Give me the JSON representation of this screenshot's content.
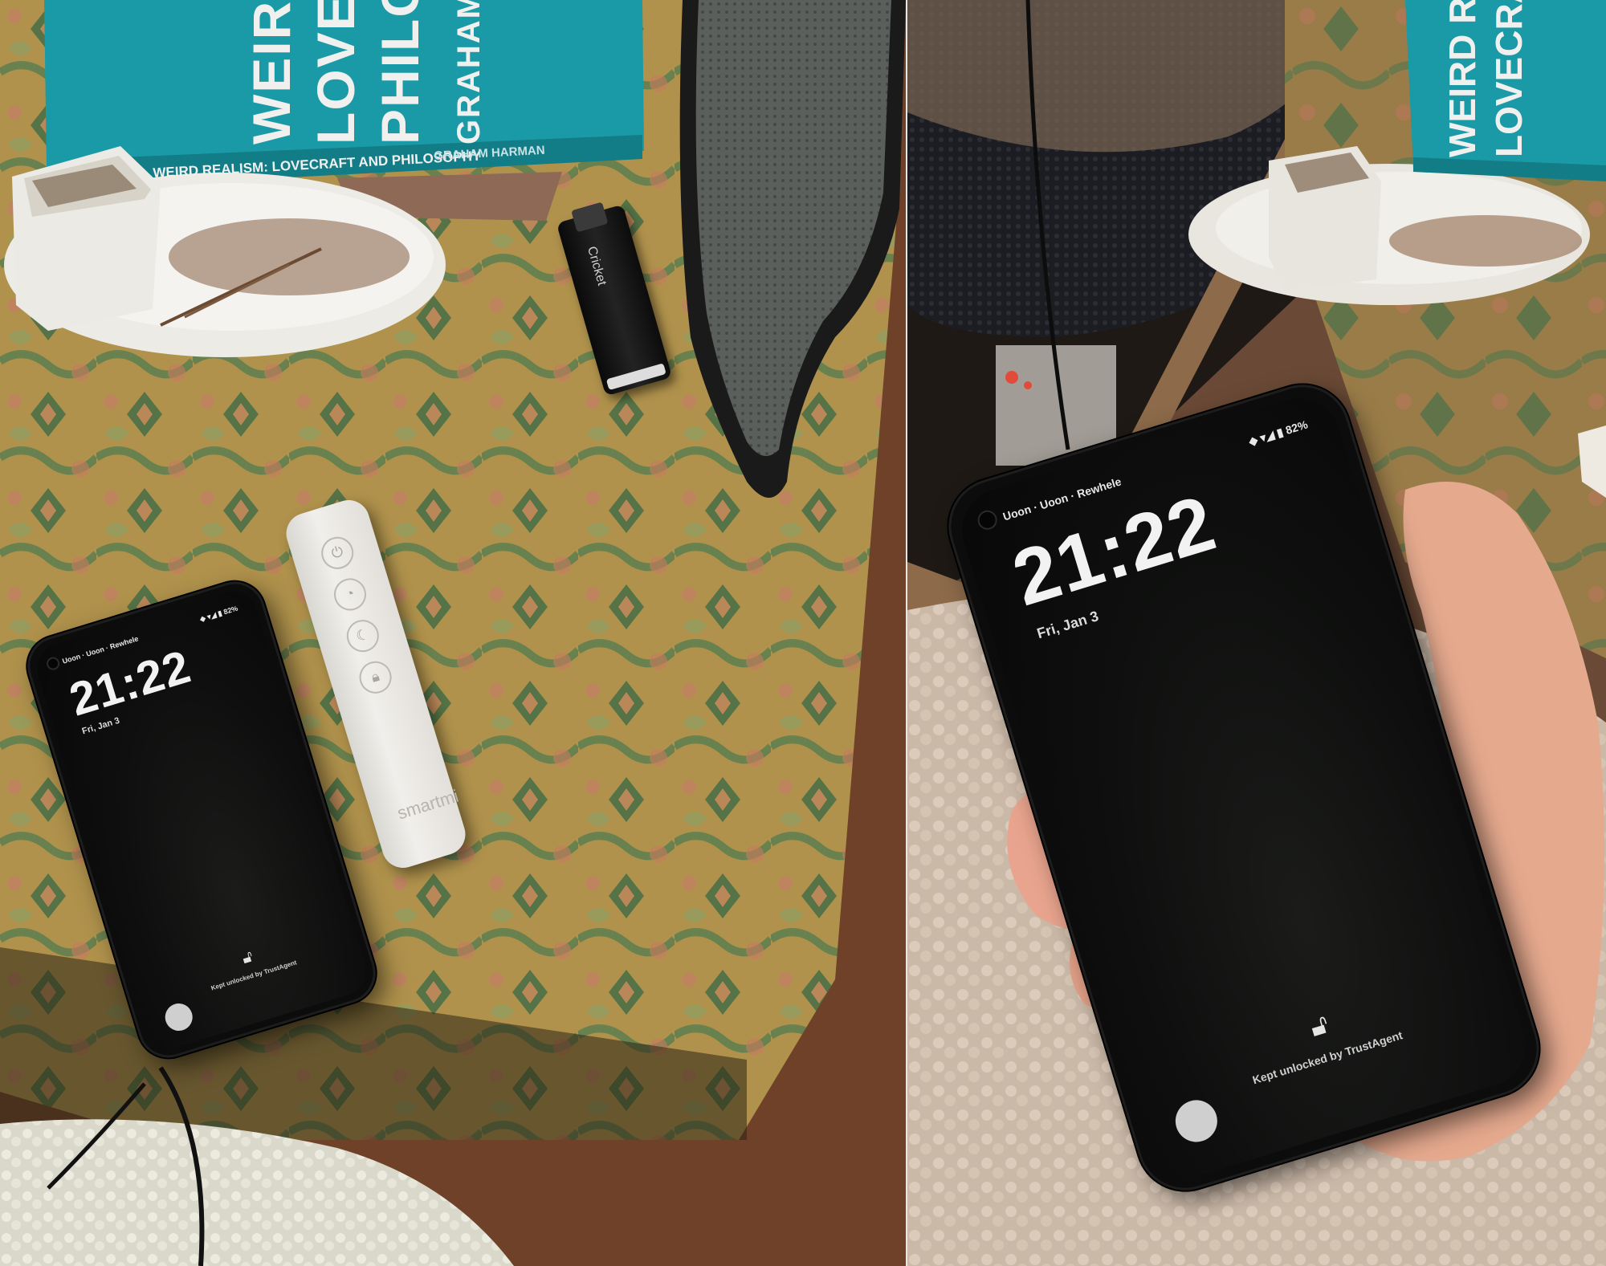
{
  "book": {
    "cover_line_1": "WEIRD R",
    "cover_line_2": "LOVECRA",
    "cover_line_3": "PHILOSO",
    "cover_author": "GRAHAM HAR",
    "spine_title": "WEIRD REALISM: LOVECRAFT AND PHILOSOPHY",
    "spine_author": "GRAHAM HARMAN"
  },
  "book_right": {
    "cover_line_1": "WEIRD REALI",
    "cover_line_2": "LOVECRAFT"
  },
  "lighter": {
    "label": "Cricket"
  },
  "remote": {
    "brand": "smartmi"
  },
  "phone_left": {
    "status_left": "Uoon · Uoon · Rewhele",
    "status_right": "◆ ▾◢ ▮ 82%",
    "time": "21:22",
    "date": "Fri, Jan 3",
    "unlock_text": "Kept unlocked by TrustAgent"
  },
  "phone_right": {
    "status_left": "Uoon · Uoon · Rewhele",
    "status_right": "◆ ▾◢ ▮ 82%",
    "time": "21:22",
    "date": "Fri, Jan 3",
    "unlock_text": "Kept unlocked by TrustAgent"
  },
  "colors": {
    "book_teal": "#1a9aa6",
    "tablecloth": "#a98c48",
    "wood": "#7a4a2c",
    "phone_black": "#0b0c0b"
  }
}
